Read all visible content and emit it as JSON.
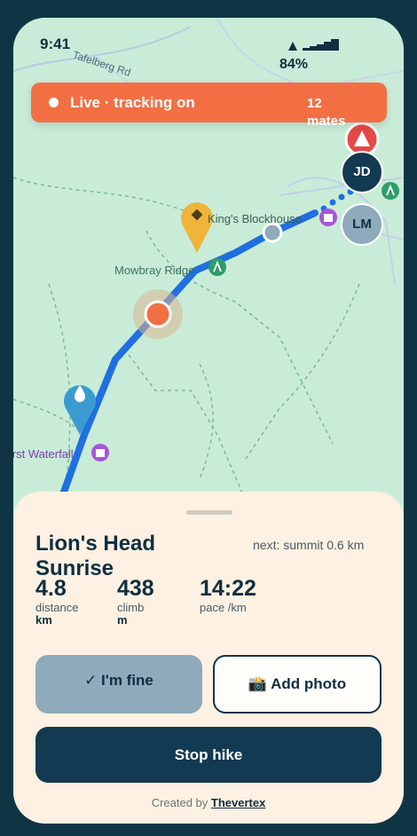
{
  "status": {
    "time": "9:41",
    "battery": "84%"
  },
  "banner": {
    "text": "Live · tracking on",
    "mates": "12 mates"
  },
  "map_labels": {
    "road": "Tafelberg Rd",
    "blockhouse": "King's Blockhouse",
    "ridge": "Mowbray Ridge",
    "waterfall": "First Waterfall"
  },
  "avatars": [
    {
      "initials": "JD"
    },
    {
      "initials": "LM"
    }
  ],
  "hike": {
    "title": "Lion's Head Sunrise",
    "next": "next: summit 0.6 km"
  },
  "stats": [
    {
      "value": "4.8",
      "label": "distance",
      "unit": "km"
    },
    {
      "value": "438",
      "label": "climb",
      "unit": "m"
    },
    {
      "value": "14:22",
      "label": "pace /km",
      "unit": ""
    }
  ],
  "actions": {
    "fine": "✓ I'm fine",
    "photo": "📸 Add photo",
    "stop": "Stop hike"
  },
  "credit": {
    "prefix": "Created by ",
    "link": "Thevertex"
  },
  "colors": {
    "accent": "#f26f44",
    "route": "#1f6fe0",
    "dark": "#123a52"
  }
}
